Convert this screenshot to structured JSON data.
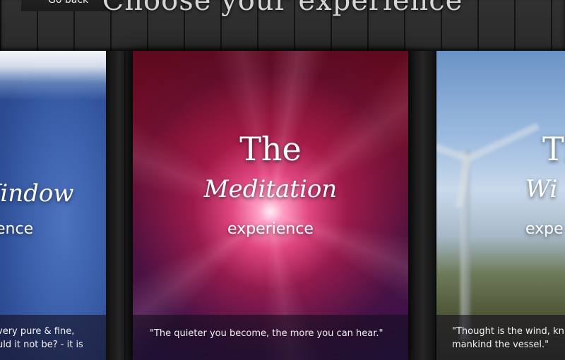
{
  "header": {
    "back_label": "Go back",
    "title": "Choose your experience"
  },
  "cards": [
    {
      "title_name": "Window",
      "title_suffix": "ence",
      "quote_line1": "very pure & fine,",
      "quote_line2": "uld it not be? - it is"
    },
    {
      "title_the": "The",
      "title_name": "Meditation",
      "title_suffix": "experience",
      "quote_line1": "\"The quieter you become, the more you can hear.\""
    },
    {
      "title_the": "Th",
      "title_name": "Wi",
      "title_suffix": "expe",
      "quote_line1": "\"Thought is the wind, kn",
      "quote_line2": "mankind the vessel.\""
    }
  ]
}
